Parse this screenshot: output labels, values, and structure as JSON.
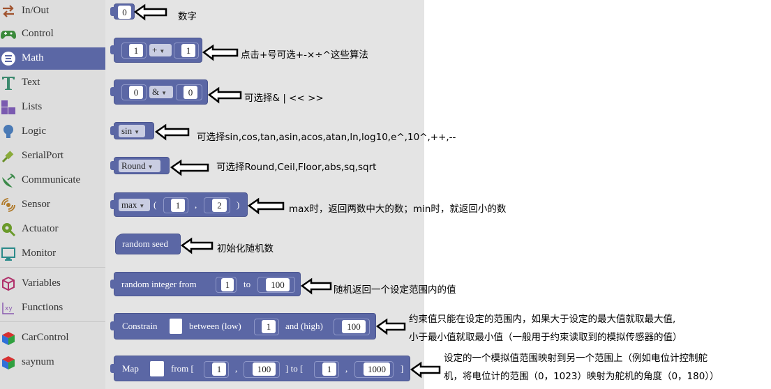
{
  "sidebar": {
    "items": [
      {
        "label": "In/Out",
        "icon": "in-out-arrows-icon"
      },
      {
        "label": "Control",
        "icon": "gamepad-icon"
      },
      {
        "label": "Math",
        "icon": "math-sigma-icon",
        "selected": true
      },
      {
        "label": "Text",
        "icon": "text-t-icon"
      },
      {
        "label": "Lists",
        "icon": "lists-blocks-icon"
      },
      {
        "label": "Logic",
        "icon": "lightbulb-icon"
      },
      {
        "label": "SerialPort",
        "icon": "usb-plug-icon"
      },
      {
        "label": "Communicate",
        "icon": "satellite-dish-icon"
      },
      {
        "label": "Sensor",
        "icon": "sensor-wave-icon"
      },
      {
        "label": "Actuator",
        "icon": "actuator-gear-icon"
      },
      {
        "label": "Monitor",
        "icon": "monitor-icon"
      },
      {
        "label": "Variables",
        "icon": "variables-cube-icon"
      },
      {
        "label": "Functions",
        "icon": "functions-fx-icon"
      },
      {
        "label": "CarControl",
        "icon": "color-cube-icon"
      },
      {
        "label": "saynum",
        "icon": "color-cube-icon"
      }
    ]
  },
  "blocks": {
    "number": {
      "value": "0"
    },
    "arith": {
      "a": "1",
      "op": "+",
      "b": "1"
    },
    "bitwise": {
      "a": "0",
      "op": "&",
      "b": "0"
    },
    "trig": {
      "func": "sin"
    },
    "round": {
      "func": "Round"
    },
    "minmax": {
      "func": "max",
      "lparen": "(",
      "a": "1",
      "comma": ",",
      "b": "2",
      "rparen": ")"
    },
    "seed": {
      "label": "random seed"
    },
    "randint": {
      "label": "random integer from",
      "from": "1",
      "to_label": "to",
      "to": "100"
    },
    "constrain": {
      "label": "Constrain",
      "between_label": "between (low)",
      "low": "1",
      "and_label": "and (high)",
      "high": "100"
    },
    "map": {
      "label": "Map",
      "from_label": "from [",
      "from_low": "1",
      "comma1": ",",
      "from_high": "100",
      "to_label": "] to [",
      "to_low": "1",
      "comma2": ",",
      "to_high": "1000",
      "close": "]"
    }
  },
  "annotations": {
    "number": "数字",
    "arith": "点击+号可选+-×÷^这些算法",
    "bitwise": "可选择& | <<   >>",
    "trig": "可选择sin,cos,tan,asin,acos,atan,ln,log10,e^,10^,++,--",
    "round": "可选择Round,Ceil,Floor,abs,sq,sqrt",
    "minmax": "max时，返回两数中大的数；min时，就返回小的数",
    "seed": "初始化随机数",
    "randint": "随机返回一个设定范围内的值",
    "constrain_line1": "约束值只能在设定的范围内，如果大于设定的最大值就取最大值,",
    "constrain_line2": "小于最小值就取最小值（一般用于约束读取到的模拟传感器的值）",
    "map_line1": "设定的一个模拟值范围映射到另一个范围上（例如电位计控制舵",
    "map_line2": "机，将电位计的范围（0，1023）映射为舵机的角度（0，180））"
  },
  "colors": {
    "block": "#5b67a5",
    "sidebar_bg": "#dddddd",
    "workspace_bg": "#e4e4e4",
    "selected": "#5b67a5"
  }
}
